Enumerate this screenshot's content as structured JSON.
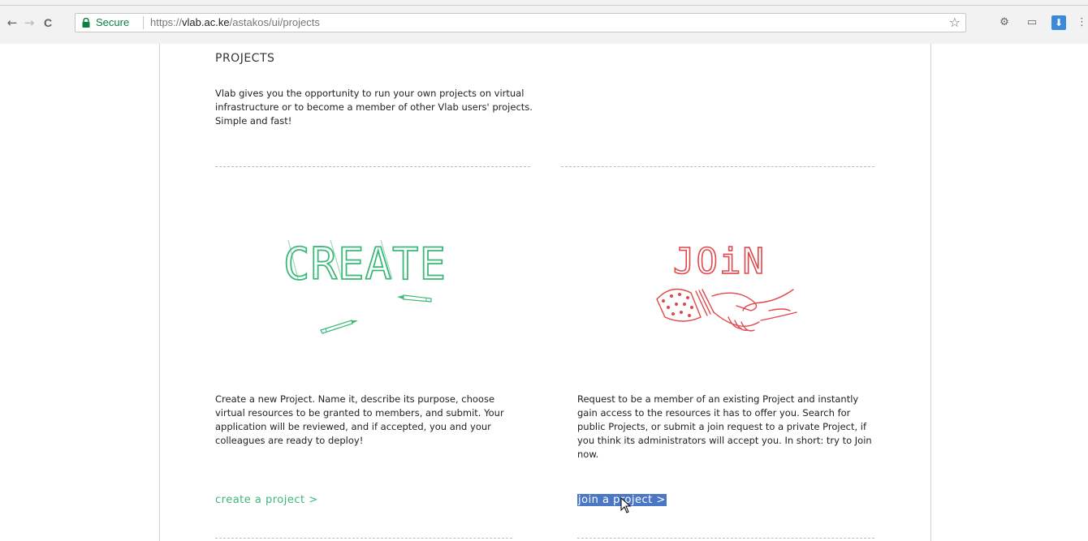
{
  "browser": {
    "back_glyph": "←",
    "forward_glyph": "→",
    "reload_glyph": "C",
    "secure_label": "Secure",
    "url_scheme": "https://",
    "url_host": "vlab.ac.ke",
    "url_path": "/astakos/ui/projects",
    "bookmark_glyph": "☆",
    "extensions": [
      {
        "name": "puzzle-extension-icon",
        "glyph": "⚙"
      },
      {
        "name": "cast-icon",
        "glyph": "▭"
      },
      {
        "name": "download-extension-icon",
        "glyph": "⬇"
      },
      {
        "name": "menu-icon",
        "glyph": "⋮"
      }
    ]
  },
  "page": {
    "title": "PROJECTS",
    "intro": "Vlab gives you the opportunity to run your own projects on virtual infrastructure or to become a member of other Vlab users' projects. Simple and fast!",
    "create": {
      "art_text": "CREATE",
      "description": "Create a new Project. Name it, describe its purpose, choose virtual resources to be granted to members, and submit. Your application will be reviewed, and if accepted, you and your colleagues are ready to deploy!",
      "link": "create a project >"
    },
    "join": {
      "art_text": "JOiN",
      "description": "Request to be a member of an existing Project and instantly gain access to the resources it has to offer you. Search for public Projects, or submit a join request to a private Project, if you think its administrators will accept you. In short: try to Join now.",
      "link": "join a project >"
    }
  },
  "colors": {
    "create_green": "#3cb878",
    "join_red": "#e2474b",
    "secure_green": "#0b8043",
    "selection_blue": "#4a78c7"
  }
}
